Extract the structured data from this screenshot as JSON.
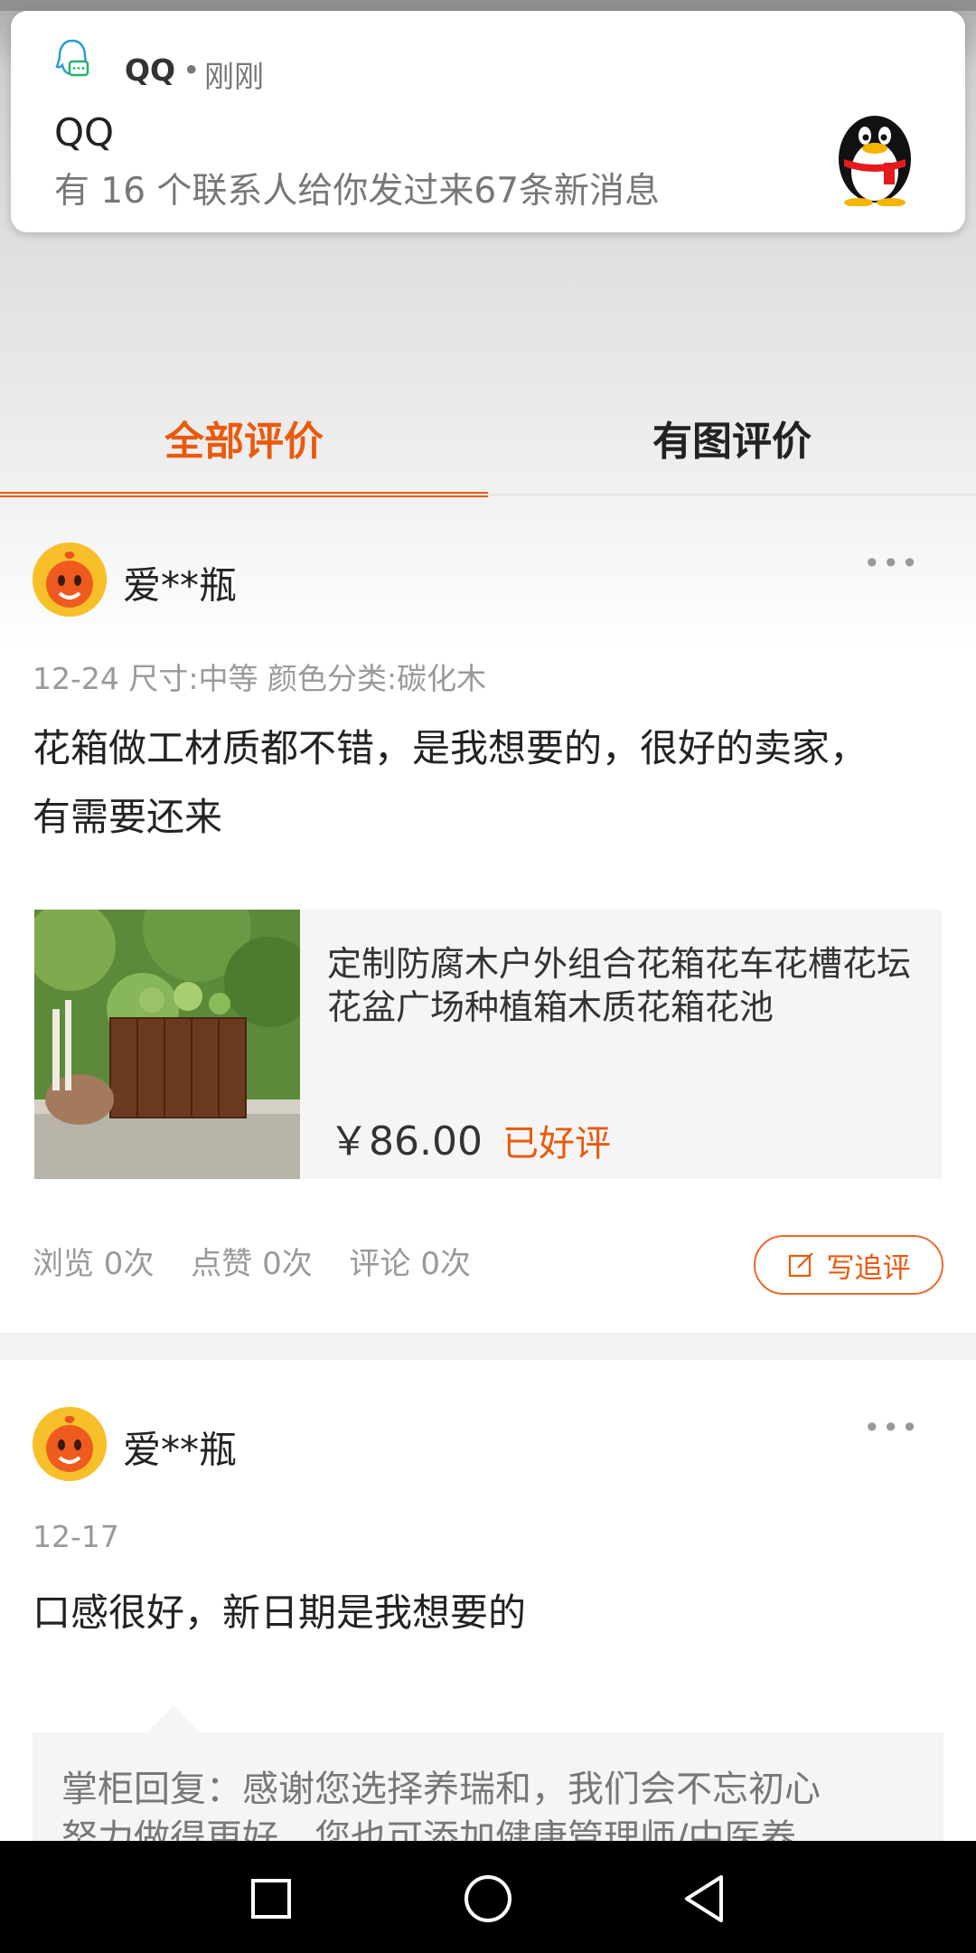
{
  "notification": {
    "app_name": "QQ",
    "separator": "•",
    "time": "刚刚",
    "title": "QQ",
    "message": "有 16 个联系人给你发过来67条新消息"
  },
  "tabs": [
    {
      "label": "全部评价",
      "active": true
    },
    {
      "label": "有图评价",
      "active": false
    }
  ],
  "reviews": [
    {
      "user": "爱**瓶",
      "meta": "12-24  尺寸:中等 颜色分类:碳化木",
      "content_line1": "花箱做工材质都不错，是我想要的，很好的卖家，",
      "content_line2": "有需要还来",
      "product": {
        "title": "定制防腐木户外组合花箱花车花槽花坛花盆广场种植箱木质花箱花池",
        "price": "￥86.00",
        "status": "已好评"
      },
      "stats": {
        "views": "浏览 0次",
        "likes": "点赞 0次",
        "comments": "评论 0次"
      },
      "follow_label": "写追评"
    },
    {
      "user": "爱**瓶",
      "meta": "12-17",
      "content_line1": "口感很好，新日期是我想要的",
      "reply_line1": "掌柜回复：感谢您选择养瑞和，我们会不忘初心",
      "reply_line2": "努力做得更好，您也可添加健康管理师/中医养"
    }
  ],
  "more_glyph": "•••",
  "colors": {
    "accent": "#ea5a0c",
    "muted": "#999999"
  },
  "icons": [
    "qq-app-icon",
    "qq-penguin-icon",
    "more-icon",
    "edit-icon",
    "square-nav-icon",
    "circle-nav-icon",
    "back-nav-icon"
  ]
}
